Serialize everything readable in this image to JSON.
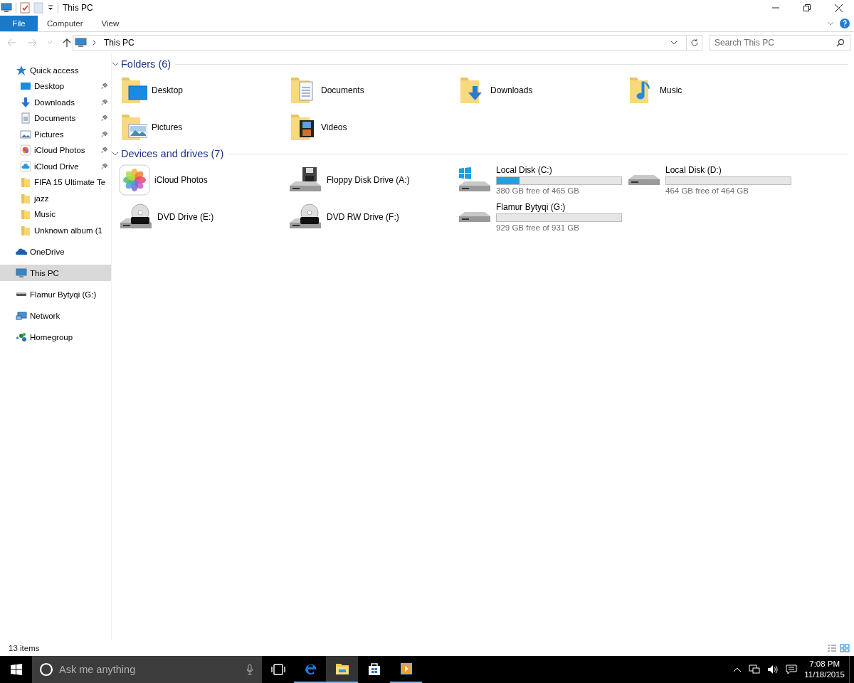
{
  "window": {
    "title": "This PC"
  },
  "ribbon": {
    "tabs": [
      {
        "label": "File",
        "selected": true
      },
      {
        "label": "Computer",
        "selected": false
      },
      {
        "label": "View",
        "selected": false
      }
    ]
  },
  "address_bar": {
    "path": "This PC"
  },
  "search": {
    "placeholder": "Search This PC"
  },
  "sidebar": {
    "items": [
      {
        "label": "Quick access",
        "kind": "star",
        "selected": false,
        "children": [
          {
            "label": "Desktop",
            "kind": "desktop",
            "pinned": true,
            "selected": false
          },
          {
            "label": "Downloads",
            "kind": "downloads",
            "pinned": true,
            "selected": false
          },
          {
            "label": "Documents",
            "kind": "documents",
            "pinned": true,
            "selected": false
          },
          {
            "label": "Pictures",
            "kind": "pictures",
            "pinned": true,
            "selected": false
          },
          {
            "label": "iCloud Photos",
            "kind": "photos",
            "pinned": true,
            "selected": false
          },
          {
            "label": "iCloud Drive",
            "kind": "cloud-drive",
            "pinned": true,
            "selected": false
          },
          {
            "label": "FIFA 15 Ultimate Te",
            "kind": "folder",
            "pinned": false,
            "selected": false
          },
          {
            "label": "jazz",
            "kind": "folder",
            "pinned": false,
            "selected": false
          },
          {
            "label": "Music",
            "kind": "folder",
            "pinned": false,
            "selected": false
          },
          {
            "label": "Unknown album (1",
            "kind": "folder",
            "pinned": false,
            "selected": false
          }
        ]
      },
      {
        "label": "OneDrive",
        "kind": "onedrive",
        "selected": false
      },
      {
        "label": "This PC",
        "kind": "pc",
        "selected": true
      },
      {
        "label": "Flamur Bytyqi (G:)",
        "kind": "usb",
        "selected": false
      },
      {
        "label": "Network",
        "kind": "network",
        "selected": false
      },
      {
        "label": "Homegroup",
        "kind": "homegroup",
        "selected": false
      }
    ]
  },
  "sections": [
    {
      "title": "Folders (6)",
      "expanded": true,
      "items": [
        {
          "label": "Desktop",
          "kind": "desktop"
        },
        {
          "label": "Documents",
          "kind": "documents"
        },
        {
          "label": "Downloads",
          "kind": "downloads"
        },
        {
          "label": "Music",
          "kind": "music"
        },
        {
          "label": "Pictures",
          "kind": "pictures"
        },
        {
          "label": "Videos",
          "kind": "videos"
        }
      ]
    },
    {
      "title": "Devices and drives (7)",
      "expanded": true,
      "items": [
        {
          "label": "iCloud Photos",
          "kind": "photos"
        },
        {
          "label": "Floppy Disk Drive (A:)",
          "kind": "floppy"
        },
        {
          "label": "Local Disk (C:)",
          "kind": "system-disk",
          "level": 0.18,
          "free": "380 GB free of 465 GB"
        },
        {
          "label": "Local Disk (D:)",
          "kind": "disk",
          "level": 0.0,
          "free": "464 GB free of 464 GB"
        },
        {
          "label": "DVD Drive (E:)",
          "kind": "dvd"
        },
        {
          "label": "DVD RW Drive (F:)",
          "kind": "dvd"
        },
        {
          "label": "Flamur Bytyqi (G:)",
          "kind": "disk",
          "level": 0.0,
          "free": "929 GB free of 931 GB"
        }
      ]
    }
  ],
  "status_bar": {
    "item_count": "13 items"
  },
  "taskbar": {
    "search_placeholder": "Ask me anything",
    "apps": [
      {
        "kind": "edge",
        "running": true,
        "selected": false
      },
      {
        "kind": "explorer",
        "running": true,
        "selected": true
      },
      {
        "kind": "store",
        "running": false,
        "selected": false
      },
      {
        "kind": "media",
        "running": true,
        "selected": false
      }
    ],
    "clock": {
      "time": "7:08 PM",
      "date": "11/18/2015"
    }
  }
}
